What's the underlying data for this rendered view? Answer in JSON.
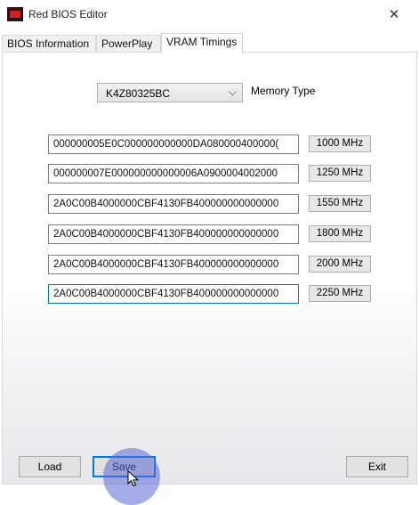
{
  "window": {
    "title": "Red BIOS Editor",
    "close_glyph": "✕",
    "icon": "red-bios-editor-app-icon"
  },
  "tabs": [
    {
      "label": "BIOS Information",
      "active": false
    },
    {
      "label": "PowerPlay",
      "active": false
    },
    {
      "label": "VRAM Timings",
      "active": true
    }
  ],
  "vram": {
    "memory_select": {
      "value": "K4Z80325BC",
      "icon": "chevron-down-icon",
      "glyph": "⌵"
    },
    "memory_label": "Memory Type",
    "timings": [
      {
        "value": "000000005E0C000000000000DA080000400000(",
        "frequency": "1000 MHz"
      },
      {
        "value": "000000007E000000000000006A0900004002000",
        "frequency": "1250 MHz"
      },
      {
        "value": "2A0C00B4000000CBF4130FB400000000000000",
        "frequency": "1550 MHz"
      },
      {
        "value": "2A0C00B4000000CBF4130FB400000000000000",
        "frequency": "1800 MHz"
      },
      {
        "value": "2A0C00B4000000CBF4130FB400000000000000",
        "frequency": "2000 MHz"
      },
      {
        "value": "2A0C00B4000000CBF4130FB400000000000000",
        "frequency": "2250 MHz",
        "focused": true
      }
    ]
  },
  "buttons": {
    "load": "Load",
    "save": "Save",
    "exit": "Exit"
  },
  "colors": {
    "accent": "#0078d7",
    "brand_red": "#d42020",
    "click_highlight": "#5c68d6"
  }
}
